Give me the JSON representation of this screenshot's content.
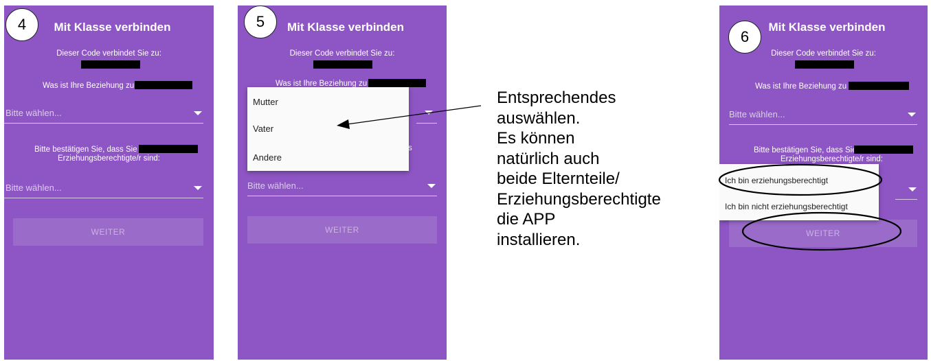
{
  "screens": [
    {
      "step": "4",
      "title": "Mit Klasse verbinden",
      "code_text": "Dieser Code verbindet Sie zu:",
      "relation_question": "Was ist Ihre Beziehung zu",
      "select1": "Bitte wählen...",
      "confirm_line1": "Bitte bestätigen Sie, dass Sie",
      "confirm_line2": "Erziehungsberechtigte/r sind:",
      "select2": "Bitte wählen...",
      "button": "WEITER"
    },
    {
      "step": "5",
      "title": "Mit Klasse verbinden",
      "code_text": "Dieser Code verbindet Sie zu:",
      "relation_question": "Was ist Ihre Beziehung zu",
      "partial_s": "s",
      "dropdown_options": [
        "Mutter",
        "Vater",
        "Andere"
      ],
      "select2": "Bitte wählen...",
      "button": "WEITER"
    },
    {
      "step": "6",
      "title": "Mit Klasse verbinden",
      "code_text": "Dieser Code verbindet Sie zu:",
      "relation_question": "Was ist Ihre Beziehung zu",
      "select1": "Bitte wählen...",
      "confirm_line1": "Bitte bestätigen Sie, dass Sie",
      "confirm_line2": "Erziehungsberechtigte/r sind:",
      "dropdown_options": [
        "Ich bin erziehungsberechtigt",
        "Ich bin nicht erziehungsberechtigt"
      ],
      "button": "WEITER"
    }
  ],
  "annotation_lines": [
    "Entsprechendes",
    "auswählen.",
    "Es können",
    "natürlich auch",
    "beide Elternteile/",
    "Erziehungsberechtigte",
    "die APP",
    "installieren."
  ],
  "colors": {
    "phone_bg": "#8e55c4",
    "button_bg": "#9a6bc9"
  }
}
